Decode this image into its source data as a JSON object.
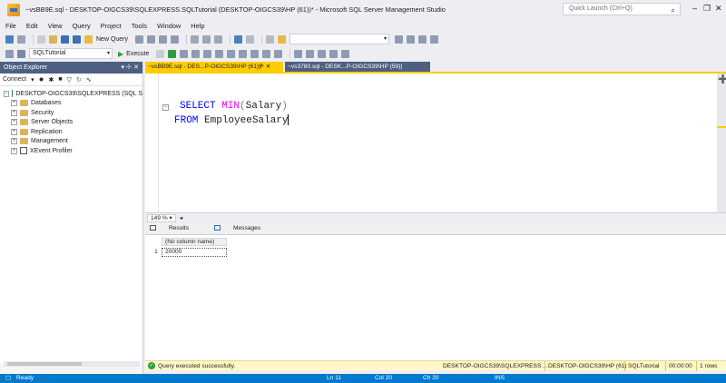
{
  "window": {
    "title": "~vsBB9E.sql - DESKTOP-OIGCS39\\SQLEXPRESS.SQLTutorial (DESKTOP-OIGCS39\\HP (61))* - Microsoft SQL Server Management Studio",
    "quick_launch_placeholder": "Quick Launch (Ctrl+Q)"
  },
  "menu": {
    "items": [
      "File",
      "Edit",
      "View",
      "Query",
      "Project",
      "Tools",
      "Window",
      "Help"
    ]
  },
  "toolbar": {
    "new_query": "New Query",
    "database": "SQLTutorial",
    "execute": "Execute"
  },
  "object_explorer": {
    "title": "Object Explorer",
    "connect": "Connect",
    "server": "DESKTOP-OIGCS39\\SQLEXPRESS (SQL S",
    "nodes": [
      "Databases",
      "Security",
      "Server Objects",
      "Replication",
      "Management",
      "XEvent Profiler"
    ]
  },
  "tabs": {
    "active": "~vsBB9E.sql - DES...P-OIGCS39\\HP (61))*",
    "second": "~vs3780.sql - DESK...P-OIGCS39\\HP (59))"
  },
  "editor": {
    "line1_kw": "SELECT",
    "line1_fn": "MIN",
    "line1_open": "(",
    "line1_arg": "Salary",
    "line1_close": ")",
    "line2_kw": "FROM",
    "line2_table": "EmployeeSalary"
  },
  "zoom": "149 %",
  "results": {
    "tab_results": "Results",
    "tab_messages": "Messages",
    "column_header": "(No column name)",
    "row_number": "1",
    "cell_value": "20000"
  },
  "query_status": {
    "message": "Query executed successfully.",
    "server": "DESKTOP-OIGCS39\\SQLEXPRESS ...",
    "user": "DESKTOP-OIGCS39\\HP (61)",
    "database": "SQLTutorial",
    "elapsed": "00:00:00",
    "rows": "1 rows"
  },
  "statusbar": {
    "ready": "Ready",
    "ln": "Ln 11",
    "col": "Col 20",
    "ch": "Ch 20",
    "mode": "INS"
  },
  "colors": {
    "accent": "#007acc",
    "active_tab": "#ffcc00",
    "panel_header": "#4d6082"
  }
}
